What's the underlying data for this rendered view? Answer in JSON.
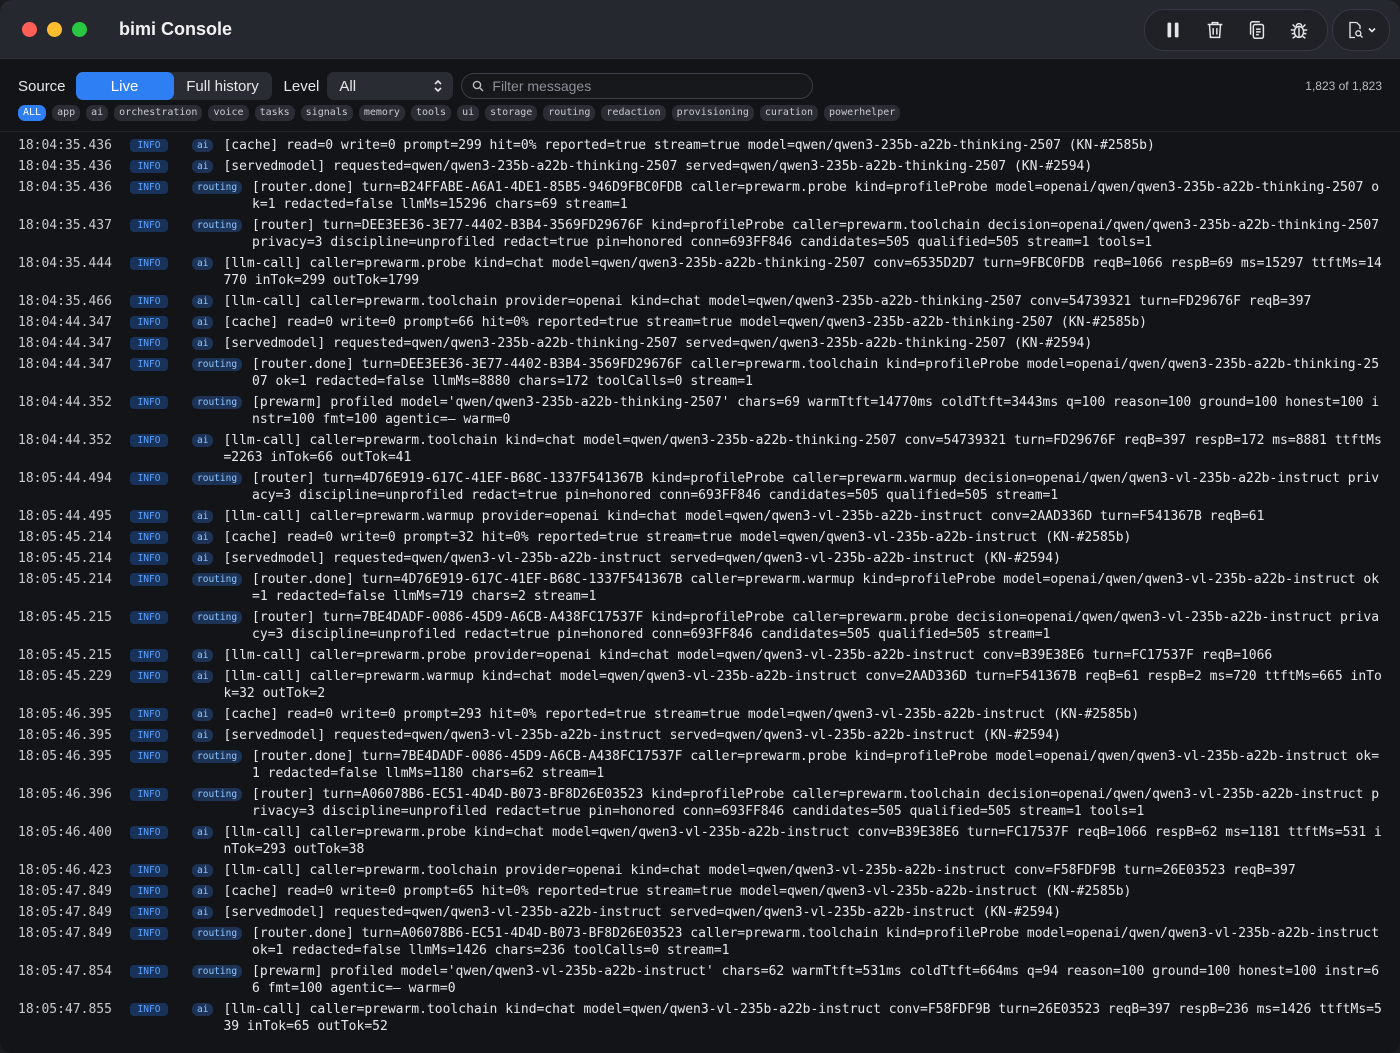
{
  "window": {
    "title": "bimi Console"
  },
  "toolbar": {
    "buttons": [
      "pause-icon",
      "trash-icon",
      "copy-icon",
      "bug-icon"
    ],
    "menu": "document-search-icon"
  },
  "filters": {
    "source_label": "Source",
    "source_live": "Live",
    "source_history": "Full history",
    "level_label": "Level",
    "level_value": "All",
    "search_placeholder": "Filter messages",
    "count": "1,823 of 1,823",
    "categories": [
      "ALL",
      "app",
      "ai",
      "orchestration",
      "voice",
      "tasks",
      "signals",
      "memory",
      "tools",
      "ui",
      "storage",
      "routing",
      "redaction",
      "provisioning",
      "curation",
      "powerhelper"
    ]
  },
  "log": [
    {
      "time": "18:04:35.436",
      "level": "INFO",
      "cat": "ai",
      "msg": "[cache] read=0 write=0 prompt=299 hit=0% reported=true stream=true model=qwen/qwen3-235b-a22b-thinking-2507 (KN-#2585b)"
    },
    {
      "time": "18:04:35.436",
      "level": "INFO",
      "cat": "ai",
      "msg": "[servedmodel] requested=qwen/qwen3-235b-a22b-thinking-2507 served=qwen/qwen3-235b-a22b-thinking-2507 (KN-#2594)"
    },
    {
      "time": "18:04:35.436",
      "level": "INFO",
      "cat": "routing",
      "msg": "[router.done] turn=B24FFABE-A6A1-4DE1-85B5-946D9FBC0FDB caller=prewarm.probe kind=profileProbe model=openai/qwen/qwen3-235b-a22b-thinking-2507 ok=1 redacted=false llmMs=15296 chars=69 stream=1"
    },
    {
      "time": "18:04:35.437",
      "level": "INFO",
      "cat": "routing",
      "msg": "[router] turn=DEE3EE36-3E77-4402-B3B4-3569FD29676F kind=profileProbe caller=prewarm.toolchain decision=openai/qwen/qwen3-235b-a22b-thinking-2507 privacy=3 discipline=unprofiled redact=true pin=honored conn=693FF846 candidates=505 qualified=505 stream=1 tools=1"
    },
    {
      "time": "18:04:35.444",
      "level": "INFO",
      "cat": "ai",
      "msg": "[llm-call] caller=prewarm.probe kind=chat model=qwen/qwen3-235b-a22b-thinking-2507 conv=6535D2D7 turn=9FBC0FDB reqB=1066 respB=69 ms=15297 ttftMs=14770 inTok=299 outTok=1799"
    },
    {
      "time": "18:04:35.466",
      "level": "INFO",
      "cat": "ai",
      "msg": "[llm-call] caller=prewarm.toolchain provider=openai kind=chat model=qwen/qwen3-235b-a22b-thinking-2507 conv=54739321 turn=FD29676F reqB=397"
    },
    {
      "time": "18:04:44.347",
      "level": "INFO",
      "cat": "ai",
      "msg": "[cache] read=0 write=0 prompt=66 hit=0% reported=true stream=true model=qwen/qwen3-235b-a22b-thinking-2507 (KN-#2585b)"
    },
    {
      "time": "18:04:44.347",
      "level": "INFO",
      "cat": "ai",
      "msg": "[servedmodel] requested=qwen/qwen3-235b-a22b-thinking-2507 served=qwen/qwen3-235b-a22b-thinking-2507 (KN-#2594)"
    },
    {
      "time": "18:04:44.347",
      "level": "INFO",
      "cat": "routing",
      "msg": "[router.done] turn=DEE3EE36-3E77-4402-B3B4-3569FD29676F caller=prewarm.toolchain kind=profileProbe model=openai/qwen/qwen3-235b-a22b-thinking-2507 ok=1 redacted=false llmMs=8880 chars=172 toolCalls=0 stream=1"
    },
    {
      "time": "18:04:44.352",
      "level": "INFO",
      "cat": "routing",
      "msg": "[prewarm] profiled model='qwen/qwen3-235b-a22b-thinking-2507' chars=69 warmTtft=14770ms coldTtft=3443ms q=100 reason=100 ground=100 honest=100 instr=100 fmt=100 agentic=— warm=0"
    },
    {
      "time": "18:04:44.352",
      "level": "INFO",
      "cat": "ai",
      "msg": "[llm-call] caller=prewarm.toolchain kind=chat model=qwen/qwen3-235b-a22b-thinking-2507 conv=54739321 turn=FD29676F reqB=397 respB=172 ms=8881 ttftMs=2263 inTok=66 outTok=41"
    },
    {
      "time": "18:05:44.494",
      "level": "INFO",
      "cat": "routing",
      "msg": "[router] turn=4D76E919-617C-41EF-B68C-1337F541367B kind=profileProbe caller=prewarm.warmup decision=openai/qwen/qwen3-vl-235b-a22b-instruct privacy=3 discipline=unprofiled redact=true pin=honored conn=693FF846 candidates=505 qualified=505 stream=1"
    },
    {
      "time": "18:05:44.495",
      "level": "INFO",
      "cat": "ai",
      "msg": "[llm-call] caller=prewarm.warmup provider=openai kind=chat model=qwen/qwen3-vl-235b-a22b-instruct conv=2AAD336D turn=F541367B reqB=61"
    },
    {
      "time": "18:05:45.214",
      "level": "INFO",
      "cat": "ai",
      "msg": "[cache] read=0 write=0 prompt=32 hit=0% reported=true stream=true model=qwen/qwen3-vl-235b-a22b-instruct (KN-#2585b)"
    },
    {
      "time": "18:05:45.214",
      "level": "INFO",
      "cat": "ai",
      "msg": "[servedmodel] requested=qwen/qwen3-vl-235b-a22b-instruct served=qwen/qwen3-vl-235b-a22b-instruct (KN-#2594)"
    },
    {
      "time": "18:05:45.214",
      "level": "INFO",
      "cat": "routing",
      "msg": "[router.done] turn=4D76E919-617C-41EF-B68C-1337F541367B caller=prewarm.warmup kind=profileProbe model=openai/qwen/qwen3-vl-235b-a22b-instruct ok=1 redacted=false llmMs=719 chars=2 stream=1"
    },
    {
      "time": "18:05:45.215",
      "level": "INFO",
      "cat": "routing",
      "msg": "[router] turn=7BE4DADF-0086-45D9-A6CB-A438FC17537F kind=profileProbe caller=prewarm.probe decision=openai/qwen/qwen3-vl-235b-a22b-instruct privacy=3 discipline=unprofiled redact=true pin=honored conn=693FF846 candidates=505 qualified=505 stream=1"
    },
    {
      "time": "18:05:45.215",
      "level": "INFO",
      "cat": "ai",
      "msg": "[llm-call] caller=prewarm.probe provider=openai kind=chat model=qwen/qwen3-vl-235b-a22b-instruct conv=B39E38E6 turn=FC17537F reqB=1066"
    },
    {
      "time": "18:05:45.229",
      "level": "INFO",
      "cat": "ai",
      "msg": "[llm-call] caller=prewarm.warmup kind=chat model=qwen/qwen3-vl-235b-a22b-instruct conv=2AAD336D turn=F541367B reqB=61 respB=2 ms=720 ttftMs=665 inTok=32 outTok=2"
    },
    {
      "time": "18:05:46.395",
      "level": "INFO",
      "cat": "ai",
      "msg": "[cache] read=0 write=0 prompt=293 hit=0% reported=true stream=true model=qwen/qwen3-vl-235b-a22b-instruct (KN-#2585b)"
    },
    {
      "time": "18:05:46.395",
      "level": "INFO",
      "cat": "ai",
      "msg": "[servedmodel] requested=qwen/qwen3-vl-235b-a22b-instruct served=qwen/qwen3-vl-235b-a22b-instruct (KN-#2594)"
    },
    {
      "time": "18:05:46.395",
      "level": "INFO",
      "cat": "routing",
      "msg": "[router.done] turn=7BE4DADF-0086-45D9-A6CB-A438FC17537F caller=prewarm.probe kind=profileProbe model=openai/qwen/qwen3-vl-235b-a22b-instruct ok=1 redacted=false llmMs=1180 chars=62 stream=1"
    },
    {
      "time": "18:05:46.396",
      "level": "INFO",
      "cat": "routing",
      "msg": "[router] turn=A06078B6-EC51-4D4D-B073-BF8D26E03523 kind=profileProbe caller=prewarm.toolchain decision=openai/qwen/qwen3-vl-235b-a22b-instruct privacy=3 discipline=unprofiled redact=true pin=honored conn=693FF846 candidates=505 qualified=505 stream=1 tools=1"
    },
    {
      "time": "18:05:46.400",
      "level": "INFO",
      "cat": "ai",
      "msg": "[llm-call] caller=prewarm.probe kind=chat model=qwen/qwen3-vl-235b-a22b-instruct conv=B39E38E6 turn=FC17537F reqB=1066 respB=62 ms=1181 ttftMs=531 inTok=293 outTok=38"
    },
    {
      "time": "18:05:46.423",
      "level": "INFO",
      "cat": "ai",
      "msg": "[llm-call] caller=prewarm.toolchain provider=openai kind=chat model=qwen/qwen3-vl-235b-a22b-instruct conv=F58FDF9B turn=26E03523 reqB=397"
    },
    {
      "time": "18:05:47.849",
      "level": "INFO",
      "cat": "ai",
      "msg": "[cache] read=0 write=0 prompt=65 hit=0% reported=true stream=true model=qwen/qwen3-vl-235b-a22b-instruct (KN-#2585b)"
    },
    {
      "time": "18:05:47.849",
      "level": "INFO",
      "cat": "ai",
      "msg": "[servedmodel] requested=qwen/qwen3-vl-235b-a22b-instruct served=qwen/qwen3-vl-235b-a22b-instruct (KN-#2594)"
    },
    {
      "time": "18:05:47.849",
      "level": "INFO",
      "cat": "routing",
      "msg": "[router.done] turn=A06078B6-EC51-4D4D-B073-BF8D26E03523 caller=prewarm.toolchain kind=profileProbe model=openai/qwen/qwen3-vl-235b-a22b-instruct ok=1 redacted=false llmMs=1426 chars=236 toolCalls=0 stream=1"
    },
    {
      "time": "18:05:47.854",
      "level": "INFO",
      "cat": "routing",
      "msg": "[prewarm] profiled model='qwen/qwen3-vl-235b-a22b-instruct' chars=62 warmTtft=531ms coldTtft=664ms q=94 reason=100 ground=100 honest=100 instr=66 fmt=100 agentic=— warm=0"
    },
    {
      "time": "18:05:47.855",
      "level": "INFO",
      "cat": "ai",
      "msg": "[llm-call] caller=prewarm.toolchain kind=chat model=qwen/qwen3-vl-235b-a22b-instruct conv=F58FDF9B turn=26E03523 reqB=397 respB=236 ms=1426 ttftMs=539 inTok=65 outTok=52"
    }
  ]
}
